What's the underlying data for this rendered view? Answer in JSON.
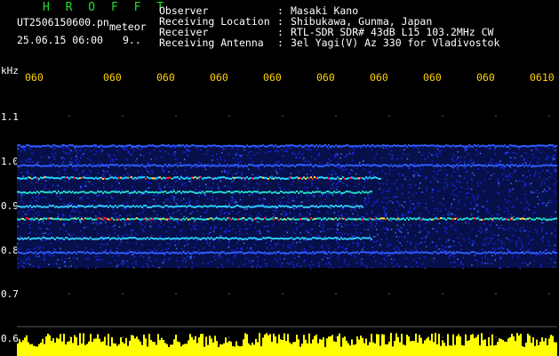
{
  "header": {
    "brand": "H R O F F T",
    "file_name": "UT2506150600.pn",
    "meteor_label": "meteor",
    "datetime": "25.06.15 06:00",
    "count": "9.."
  },
  "info": [
    {
      "label": "Observer",
      "value": "Masaki Kano"
    },
    {
      "label": "Receiving Location",
      "value": "Shibukawa, Gunma, Japan"
    },
    {
      "label": "Receiver",
      "value": "RTL-SDR SDR# 43dB L15 103.2MHz CW"
    },
    {
      "label": "Receiving Antenna",
      "value": "3el Yagi(V) Az 330 for Vladivostok"
    }
  ],
  "axis": {
    "unit": "kHz",
    "time_ticks": [
      "060",
      "060",
      "060",
      "060",
      "060",
      "060",
      "060",
      "060",
      "060",
      "0610"
    ],
    "freq_labels": [
      "1.1",
      "1.0",
      "0.9",
      "0.8",
      "0.7",
      "0.6"
    ]
  },
  "colors": {
    "label_green": "#22e02a",
    "tick_yellow": "#ffd200",
    "noise_blue": "#1a2bff",
    "signal_red": "#ff1e1e"
  }
}
